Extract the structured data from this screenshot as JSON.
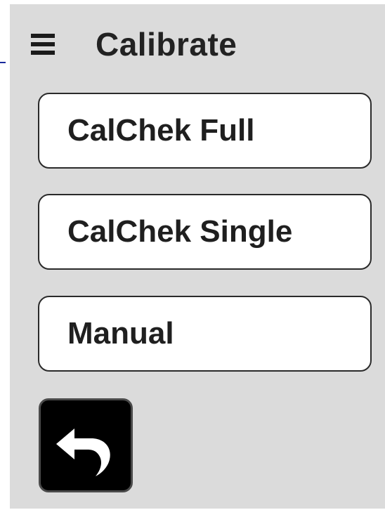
{
  "header": {
    "title": "Calibrate",
    "menu_icon": "hamburger-menu-icon"
  },
  "options": [
    {
      "label": "CalChek Full"
    },
    {
      "label": "CalChek Single"
    },
    {
      "label": "Manual"
    }
  ],
  "back": {
    "icon": "undo-arrow-icon"
  },
  "colors": {
    "panel_background": "#dbdbdb",
    "button_background": "#ffffff",
    "back_button_background": "#000000",
    "text": "#222222"
  }
}
